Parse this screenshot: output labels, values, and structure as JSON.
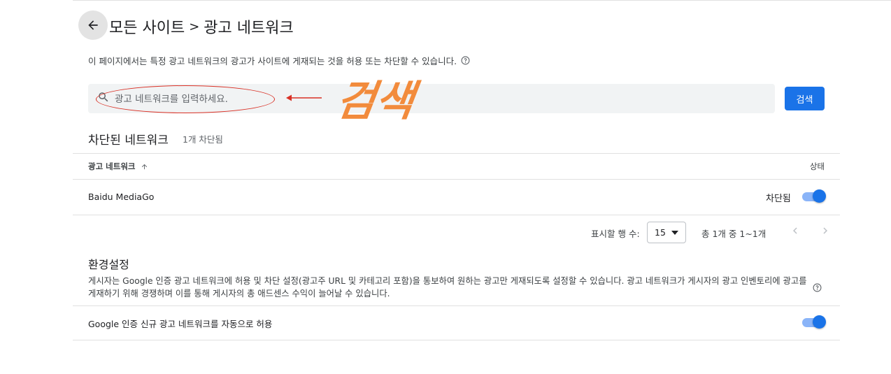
{
  "header": {
    "breadcrumb_parent": "모든 사이트",
    "separator": ">",
    "current_page": "광고 네트워크"
  },
  "description": "이 페이지에서는 특정 광고 네트워크의 광고가 사이트에 게재되는 것을 허용 또는 차단할 수 있습니다.",
  "search": {
    "placeholder": "광고 네트워크를 입력하세요.",
    "value": "",
    "button_label": "검색"
  },
  "annotation": {
    "text": "검색",
    "color": "#f28b3c",
    "ellipse_color": "#d93025"
  },
  "blocked_section": {
    "title": "차단된 네트워크",
    "count": "1개 차단됨",
    "columns": {
      "network": "광고 네트워크",
      "status": "상태"
    },
    "rows": [
      {
        "network": "Baidu MediaGo",
        "status": "차단됨",
        "toggle_on": true
      }
    ]
  },
  "pagination": {
    "rows_per_page_label": "표시할 행 수:",
    "rows_per_page_value": "15",
    "range": "총 1개 중 1~1개"
  },
  "settings": {
    "title": "환경설정",
    "description": "게시자는 Google 인증 광고 네트워크에 허용 및 차단 설정(광고주 URL 및 카테고리 포함)을 통보하여 원하는 광고만 게재되도록 설정할 수 있습니다. 광고 네트워크가 게시자의 광고 인벤토리에 광고를 게재하기 위해 경쟁하며 이를 통해 게시자의 총 애드센스 수익이 늘어날 수 있습니다.",
    "auto_allow_label": "Google 인증 신규 광고 네트워크를 자동으로 허용",
    "auto_allow_on": true
  },
  "colors": {
    "primary": "#1a73e8",
    "toggle_track": "#8ab4f8",
    "divider": "#e0e0e0"
  }
}
